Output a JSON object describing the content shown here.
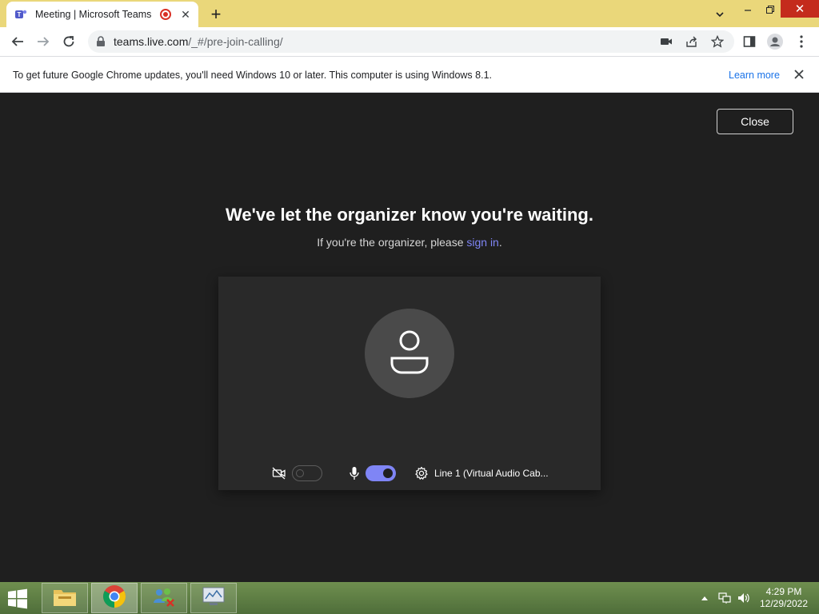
{
  "browser": {
    "tab": {
      "title": "Meeting | Microsoft Teams"
    },
    "url": {
      "host": "teams.live.com",
      "path": "/_#/pre-join-calling/"
    },
    "infobar": {
      "message": "To get future Google Chrome updates, you'll need Windows 10 or later. This computer is using Windows 8.1.",
      "learn_more": "Learn more"
    }
  },
  "page": {
    "close_label": "Close",
    "headline": "We've let the organizer know you're waiting.",
    "subline_prefix": "If you're the organizer, please ",
    "subline_link": "sign in",
    "subline_suffix": ".",
    "controls": {
      "camera_on": false,
      "mic_on": true,
      "device_label": "Line 1 (Virtual Audio Cab..."
    }
  },
  "taskbar": {
    "time": "4:29 PM",
    "date": "12/29/2022"
  },
  "colors": {
    "accent": "#7f85f5",
    "chrome_frame": "#ead77a",
    "page_bg": "#1f1f1f"
  }
}
